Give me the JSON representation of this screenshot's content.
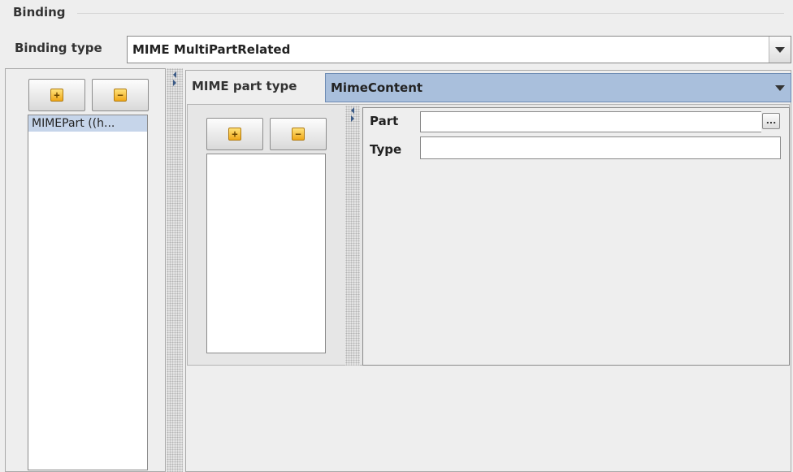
{
  "group": {
    "title": "Binding"
  },
  "binding_type": {
    "label": "Binding type",
    "value": "MIME MultiPartRelated"
  },
  "parts_list": {
    "add_icon": "plus-icon",
    "remove_icon": "minus-icon",
    "items": [
      "MIMEPart ((h..."
    ],
    "selected_index": 0
  },
  "mime_part_type": {
    "label": "MIME part type",
    "value": "MimeContent"
  },
  "sub_list": {
    "add_icon": "plus-icon",
    "remove_icon": "minus-icon",
    "items": []
  },
  "properties": {
    "part_label": "Part",
    "part_value": "",
    "part_button": "...",
    "type_label": "Type",
    "type_value": ""
  },
  "colors": {
    "selection": "#c6d5ea",
    "combo_highlight": "#a9bfdc",
    "icon_fill": "#f0a818"
  }
}
